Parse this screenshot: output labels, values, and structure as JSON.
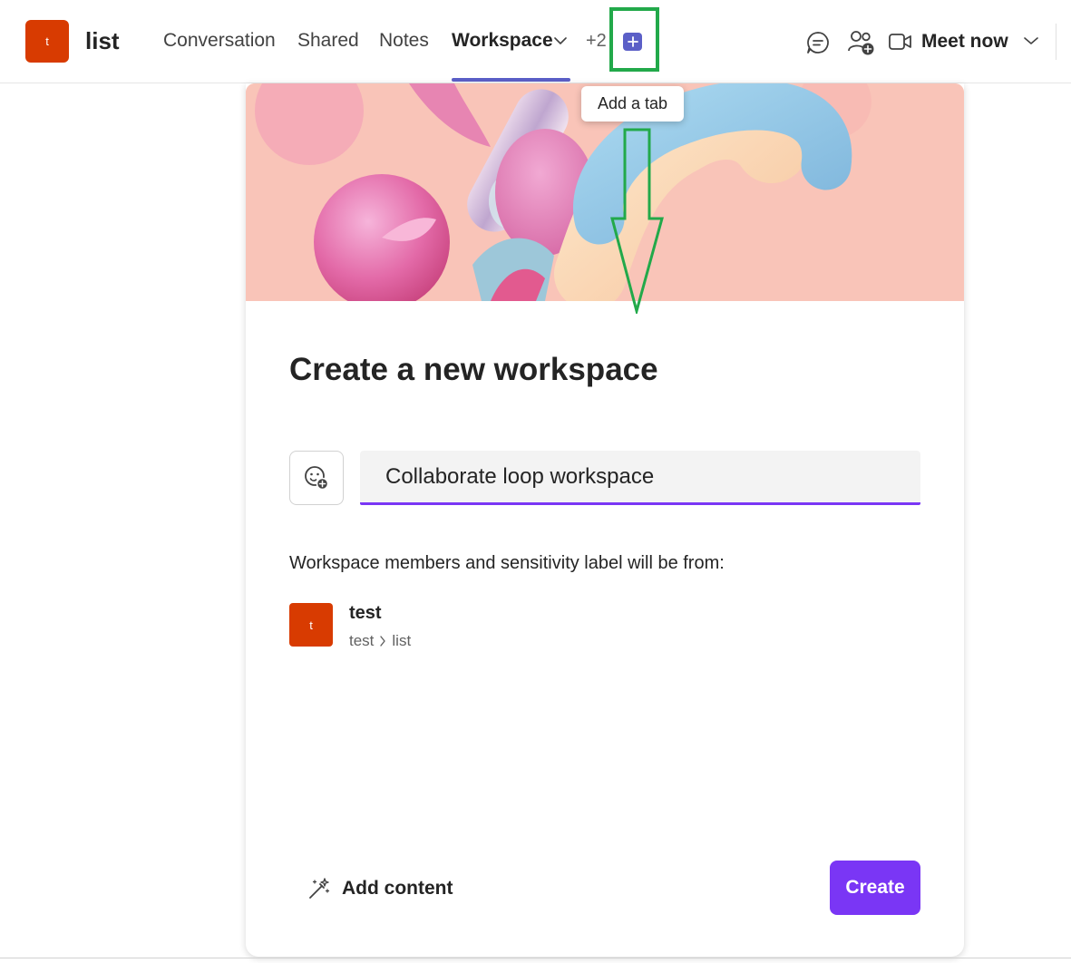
{
  "channel": {
    "avatar_letter": "t",
    "avatar_color": "#d83b01",
    "title": "list"
  },
  "tabs": [
    {
      "label": "Conversation",
      "active": false
    },
    {
      "label": "Shared",
      "active": false
    },
    {
      "label": "Notes",
      "active": false
    },
    {
      "label": "Workspace",
      "active": true
    }
  ],
  "more_tabs": "+2",
  "add_tab_tooltip": "Add a tab",
  "header_actions": {
    "chat_icon": "chat-icon",
    "people_icon": "people-add-icon",
    "video_icon": "video-camera-icon",
    "meet_now_label": "Meet now"
  },
  "card": {
    "title": "Create a new workspace",
    "emoji_icon": "emoji-add-icon",
    "name_input_value": "Collaborate loop workspace",
    "members_note": "Workspace members and sensitivity label will be from:",
    "source": {
      "avatar_letter": "t",
      "name": "test",
      "path_team": "test",
      "path_channel": "list"
    },
    "add_content_label": "Add content",
    "create_label": "Create"
  },
  "colors": {
    "accent": "#5b5fc7",
    "create_button": "#7a36f5",
    "annotation": "#22a94a"
  }
}
